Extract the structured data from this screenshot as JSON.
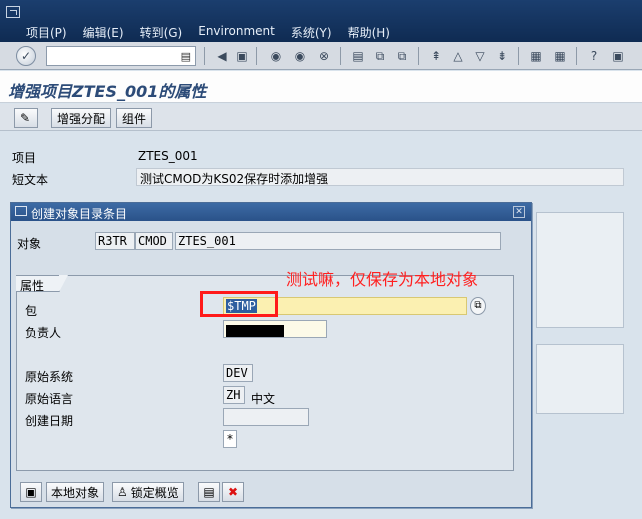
{
  "menu": {
    "items": [
      "项目(P)",
      "编辑(E)",
      "转到(G)",
      "Environment",
      "系统(Y)",
      "帮助(H)"
    ]
  },
  "toolbar": {
    "command_value": ""
  },
  "page": {
    "title": "增强项目ZTES_001的属性"
  },
  "app_toolbar": {
    "enhance_assign": "增强分配",
    "components": "组件"
  },
  "main": {
    "project_label": "项目",
    "project_value": "ZTES_001",
    "short_text_label": "短文本",
    "short_text_value": "测试CMOD为KS02保存时添加增强"
  },
  "dialog": {
    "title": "创建对象目录条目",
    "object_label": "对象",
    "object_pgmid": "R3TR",
    "object_type": "CMOD",
    "object_name": "ZTES_001",
    "group_label": "属性",
    "package_label": "包",
    "package_value": "$TMP",
    "owner_label": "负责人",
    "owner_value": "",
    "orig_system_label": "原始系统",
    "orig_system_value": "DEV",
    "orig_lang_label": "原始语言",
    "orig_lang_code": "ZH",
    "orig_lang_name": "中文",
    "created_date_label": "创建日期",
    "created_date_value": "",
    "star_value": "*",
    "footer": {
      "local_object": "本地对象",
      "lock_overview": "锁定概览"
    }
  },
  "annotation": {
    "text": "测试嘛，仅保存为本地对象",
    "color": "#ff2020"
  }
}
